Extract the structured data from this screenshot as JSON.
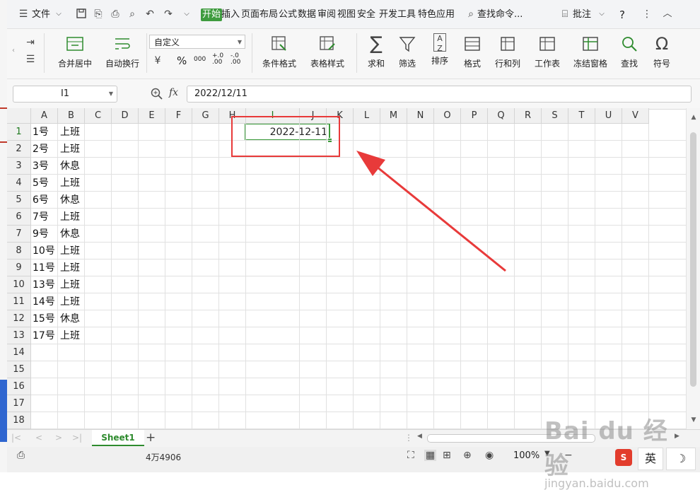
{
  "menubar": {
    "file_label": "文件",
    "tabs": [
      "开始",
      "插入",
      "页面布局",
      "公式",
      "数据",
      "审阅",
      "视图",
      "安全",
      "开发工具",
      "特色应用"
    ],
    "search_label": "查找命令...",
    "comment_label": "批注",
    "help_label": "?"
  },
  "ribbon": {
    "merge_center": "合并居中",
    "wrap_text": "自动换行",
    "number_format": "自定义",
    "percent": "%",
    "thousands": "000",
    "dec_add": "+.0 .00",
    "dec_remove": "-.0 .00",
    "cond_format": "条件格式",
    "table_style": "表格样式",
    "sum": "求和",
    "filter": "筛选",
    "sort": "排序",
    "format": "格式",
    "row_col": "行和列",
    "worksheet": "工作表",
    "freeze": "冻结窗格",
    "find": "查找",
    "symbol": "符号"
  },
  "formula_bar": {
    "name_box": "I1",
    "fx": "fx",
    "content": "2022/12/11"
  },
  "grid": {
    "columns": [
      "A",
      "B",
      "C",
      "D",
      "E",
      "F",
      "G",
      "H",
      "I",
      "J",
      "K",
      "L",
      "M",
      "N",
      "O",
      "P",
      "Q",
      "R",
      "S",
      "T",
      "U",
      "V"
    ],
    "rows": [
      "1",
      "2",
      "3",
      "4",
      "5",
      "6",
      "7",
      "8",
      "9",
      "10",
      "11",
      "12",
      "13",
      "14",
      "15",
      "16",
      "17",
      "18"
    ],
    "col_a": [
      "1号",
      "2号",
      "3号",
      "5号",
      "6号",
      "7号",
      "9号",
      "10号",
      "11号",
      "13号",
      "14号",
      "15号",
      "17号"
    ],
    "col_b": [
      "上班",
      "上班",
      "休息",
      "上班",
      "休息",
      "上班",
      "休息",
      "上班",
      "上班",
      "上班",
      "上班",
      "休息",
      "上班"
    ],
    "selected_cell": "I1",
    "selected_value": "2022-12-11"
  },
  "sheet_tabs": {
    "active": "Sheet1",
    "add": "+"
  },
  "statusbar": {
    "count": "4万4906",
    "zoom": "100%"
  },
  "watermark": {
    "brand": "Bai du 经验",
    "url": "jingyan.baidu.com"
  },
  "ime": {
    "engine": "S",
    "lang": "英",
    "mode": "☽"
  },
  "colors": {
    "accent": "#3e9b3e",
    "annotation": "#e83a3a"
  }
}
